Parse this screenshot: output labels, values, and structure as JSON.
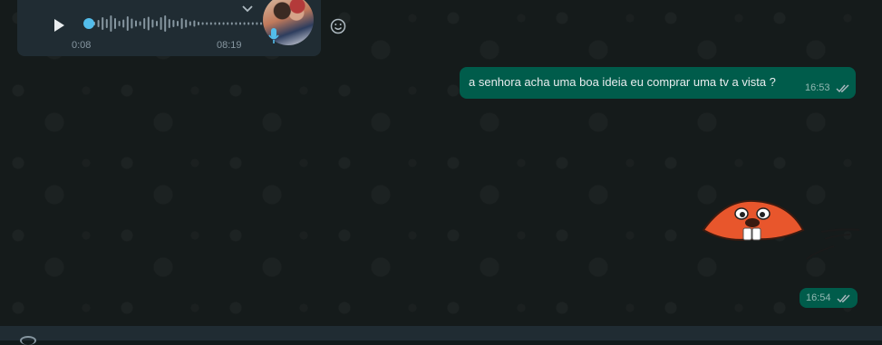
{
  "audio_message": {
    "current_time": "0:08",
    "duration": "08:19",
    "progress": 0.016
  },
  "outgoing_text_message": {
    "text": "a senhora acha uma boa ideia eu comprar uma tv a vista ?",
    "time": "16:53",
    "status": "read"
  },
  "sticker_message": {
    "sticker": "beaver-face-sticker",
    "time": "16:54",
    "status": "read"
  },
  "colors": {
    "chat_background": "#151b1b",
    "incoming_bubble": "#202c33",
    "outgoing_bubble": "#005c4b",
    "accent": "#53bdeb",
    "secondary_text": "#8696a0"
  }
}
